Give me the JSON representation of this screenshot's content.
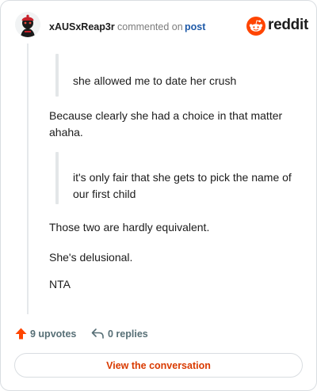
{
  "header": {
    "username": "xAUSxReap3r",
    "action_text": "commented on",
    "post_link": "post",
    "brand": "reddit"
  },
  "comment": {
    "quote1": "she allowed me to date her crush",
    "para1": "Because clearly she had a choice in that matter ahaha.",
    "quote2": "it's only fair that she gets to pick the name of our first child",
    "para2": "Those two are hardly equivalent.",
    "para3": "She's delusional.",
    "para4": "NTA"
  },
  "footer": {
    "upvotes": "9 upvotes",
    "replies": "0 replies",
    "view_button": "View the conversation"
  },
  "colors": {
    "accent": "#d93a00",
    "upvote": "#ff4500",
    "link": "#1f5aa8",
    "meta": "#576f76"
  },
  "icons": [
    "avatar-icon",
    "reddit-logo-icon",
    "upvote-arrow-icon",
    "reply-icon"
  ]
}
